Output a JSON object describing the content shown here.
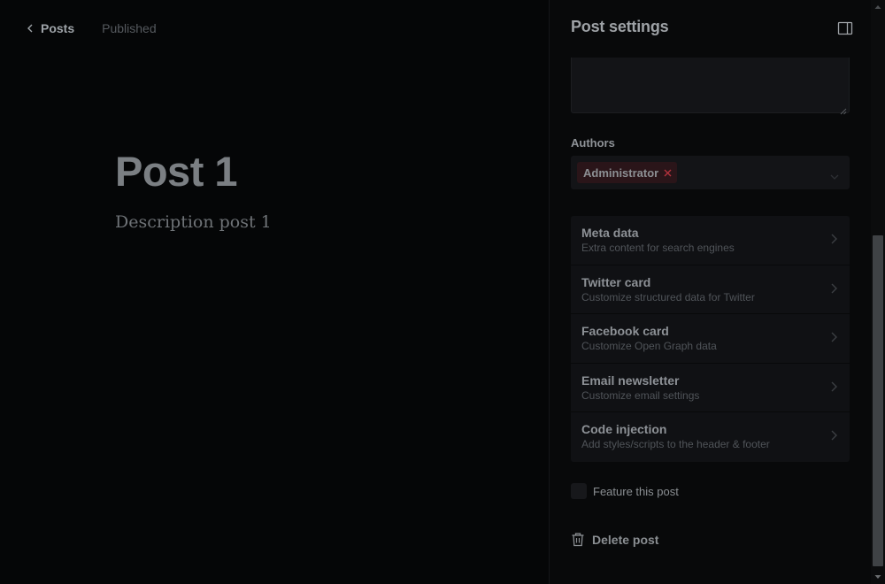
{
  "header": {
    "back_label": "Posts",
    "status": "Published"
  },
  "post": {
    "title": "Post 1",
    "description": "Description post 1"
  },
  "settings": {
    "title": "Post settings",
    "authors_label": "Authors",
    "authors": [
      "Administrator"
    ],
    "menu": [
      {
        "title": "Meta data",
        "subtitle": "Extra content for search engines"
      },
      {
        "title": "Twitter card",
        "subtitle": "Customize structured data for Twitter"
      },
      {
        "title": "Facebook card",
        "subtitle": "Customize Open Graph data"
      },
      {
        "title": "Email newsletter",
        "subtitle": "Customize email settings"
      },
      {
        "title": "Code injection",
        "subtitle": "Add styles/scripts to the header & footer"
      }
    ],
    "feature_label": "Feature this post",
    "feature_checked": false,
    "delete_label": "Delete post"
  },
  "icons": {
    "back": "chevron-left-icon",
    "panel_toggle": "sidebar-toggle-icon",
    "author_remove": "close-icon",
    "authors_dropdown": "chevron-down-icon",
    "menu_arrow": "chevron-right-icon",
    "delete": "trash-icon"
  },
  "colors": {
    "background": "#050607",
    "panel": "#08090a",
    "field": "#131417",
    "author_tag": "#2a1519",
    "author_remove": "#b3323c"
  }
}
